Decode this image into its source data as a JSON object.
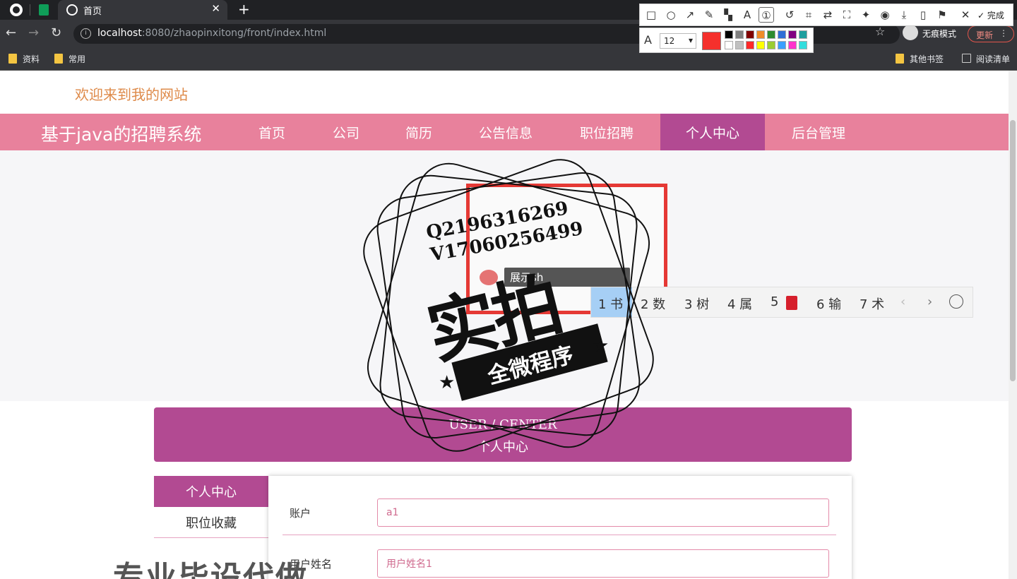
{
  "browser": {
    "tab_title": "首页",
    "url_host": "localhost",
    "url_rest": ":8080/zhaopinxitong/front/index.html",
    "incognito_label": "无痕模式",
    "update_label": "更新",
    "bookmarks": [
      "资料",
      "常用",
      "其他书签",
      "阅读清单"
    ]
  },
  "annotation_toolbar": {
    "done_label": "完成",
    "font_size": "12",
    "current_color": "#f5302c",
    "palette": [
      "#000000",
      "#808080",
      "#800000",
      "#f08c2a",
      "#2e8b2e",
      "#2f6fd6",
      "#800080",
      "#1e9e9e",
      "#ffffff",
      "#c0c0c0",
      "#ff2a2a",
      "#ffff00",
      "#9acd32",
      "#3aa0ff",
      "#ff33cc",
      "#33dddd"
    ]
  },
  "page": {
    "welcome": "欢迎来到我的网站",
    "site_title": "基于java的招聘系统",
    "nav": [
      "首页",
      "公司",
      "简历",
      "公告信息",
      "职位招聘",
      "个人中心",
      "后台管理"
    ],
    "accent_color": "#b24a92",
    "nav_color": "#e8819c"
  },
  "ime": {
    "composition": "展示sh",
    "candidates": [
      "1 书",
      "2 数",
      "3 树",
      "4 属",
      "5",
      "6 输",
      "7 术"
    ]
  },
  "user_center": {
    "title_en": "USER / CENTER",
    "title_cn": "个人中心",
    "menu": [
      "个人中心",
      "职位收藏"
    ],
    "form": {
      "account_label": "账户",
      "account_value": "a1",
      "name_label": "用户姓名",
      "name_value": "用户姓名1"
    }
  },
  "watermark": {
    "contact_q": "Q2196316269",
    "contact_v": "V17060256499",
    "big_text": "实拍",
    "ribbon_text": "全微程序",
    "bottom_text": "专业毕设代做"
  }
}
